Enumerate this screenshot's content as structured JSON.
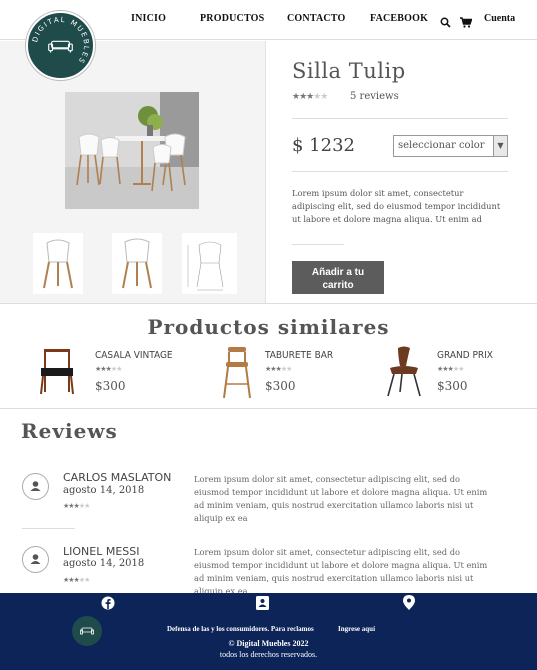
{
  "header": {
    "logo_text": "DIGITAL MUEBLES",
    "nav": [
      "INICIO",
      "PRODUCTOS",
      "CONTACTO",
      "FACEBOOK"
    ],
    "account_label": "Cuenta",
    "icons": [
      "search-icon",
      "cart-icon"
    ]
  },
  "product": {
    "title": "Silla Tulip",
    "rating": 3,
    "rating_max": 5,
    "reviews_count": "5 reviews",
    "price": "$ 1232",
    "color_select": {
      "selected": "seleccionar color"
    },
    "description": "Lorem ipsum dolor sit amet, consectetur adipiscing elit, sed do eiusmod tempor incididunt ut labore et dolore magna aliqua. Ut enim ad",
    "cart_button": "Añadir a tu carrito"
  },
  "similar": {
    "title": "Productos similares",
    "items": [
      {
        "name": "CASALA VINTAGE",
        "price": "$300",
        "rating": 3
      },
      {
        "name": "TABURETE BAR",
        "price": "$300",
        "rating": 3
      },
      {
        "name": "GRAND PRIX",
        "price": "$300",
        "rating": 3
      }
    ]
  },
  "reviews": {
    "title": "Reviews",
    "items": [
      {
        "name": "CARLOS MASLATON",
        "date": "agosto 14, 2018",
        "rating": 3,
        "text": "Lorem ipsum dolor sit amet, consectetur adipiscing elit, sed do eiusmod tempor incididunt ut labore et dolore magna aliqua. Ut enim ad minim veniam, quis nostrud exercitation ullamco laboris nisi ut aliquip ex ea"
      },
      {
        "name": "LIONEL MESSI",
        "date": "agosto 14, 2018",
        "rating": 3,
        "text": "Lorem ipsum dolor sit amet, consectetur adipiscing elit, sed do eiusmod tempor incididunt ut labore et dolore magna aliqua. Ut enim ad minim veniam, quis nostrud exercitation ullamco laboris nisi ut aliquip ex ea"
      }
    ]
  },
  "footer": {
    "icons": [
      "facebook-icon",
      "contact-card-icon",
      "location-icon"
    ],
    "consumer_text": "Defensa de las y los consumidores. Para reclamos",
    "consumer_link": "Ingrese aquí",
    "copyright": "© Digital Muebles 2022",
    "rights": "todos los derechos reservados."
  },
  "colors": {
    "footer_bg": "#0c2457",
    "logo_bg": "#1f4b4b",
    "button_bg": "#5c5c5c"
  }
}
